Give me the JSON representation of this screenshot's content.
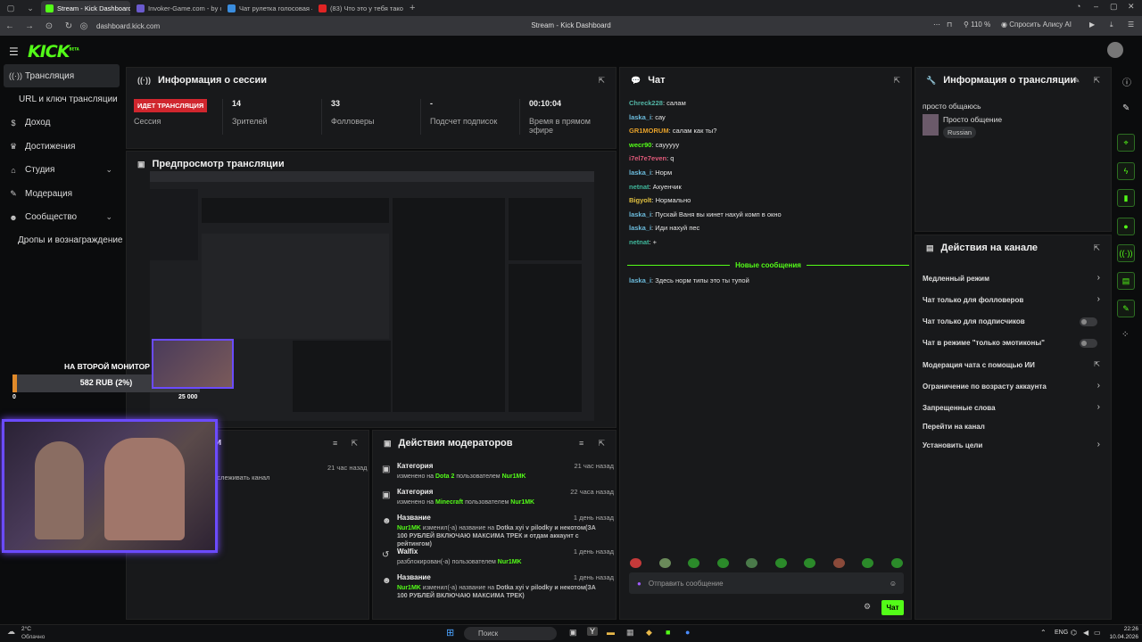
{
  "browser": {
    "tabs": [
      {
        "label": "Stream - Kick Dashboard",
        "color": "#53fc18",
        "active": true
      },
      {
        "label": "Invoker-Game.com - by co",
        "color": "#6a5acd",
        "active": false
      },
      {
        "label": "Чат рулетка голосовая –",
        "color": "#3a8dde",
        "active": false
      },
      {
        "label": "(83) Что это у тебя такое",
        "color": "#e02424",
        "active": false
      }
    ],
    "url": "dashboard.kick.com",
    "page_title": "Stream - Kick Dashboard",
    "zoom": "110 %",
    "alice": "Спросить Алису AI"
  },
  "kick": {
    "logo": "KICK",
    "logo_sup": "BETA"
  },
  "sidebar": {
    "items": [
      {
        "label": "Трансляция",
        "icon": "broadcast-icon"
      },
      {
        "label": "URL и ключ трансляции",
        "icon": ""
      },
      {
        "label": "Доход",
        "icon": "dollar-icon"
      },
      {
        "label": "Достижения",
        "icon": "trophy-icon"
      },
      {
        "label": "Студия",
        "icon": "studio-icon"
      },
      {
        "label": "Модерация",
        "icon": "wrench-icon"
      },
      {
        "label": "Сообщество",
        "icon": "community-icon"
      },
      {
        "label": "Дропы и вознаграждение",
        "icon": ""
      }
    ]
  },
  "session": {
    "title": "Информация о сессии",
    "live_badge": "ИДЕТ ТРАНСЛЯЦИЯ",
    "session_label": "Сессия",
    "viewers_value": "14",
    "viewers_label": "Зрителей",
    "followers_value": "33",
    "followers_label": "Фолловеры",
    "subs_value": "-",
    "subs_label": "Подсчет подписок",
    "time_value": "00:10:04",
    "time_label": "Время в прямом эфире"
  },
  "preview": {
    "title": "Предпросмотр трансляции"
  },
  "chat": {
    "title": "Чат",
    "messages": [
      {
        "user": "Chreck228",
        "text": "салам",
        "color": "#53b6a6"
      },
      {
        "user": "laska_i",
        "text": "сау",
        "color": "#6bbbdc"
      },
      {
        "user": "GR1MORUM",
        "text": "салам как ты?",
        "color": "#e6a12a"
      },
      {
        "user": "wecr90",
        "text": "сауyyyy",
        "color": "#53fc18"
      },
      {
        "user": "i7el7e7even",
        "text": "q",
        "color": "#e05a7a"
      },
      {
        "user": "laska_i",
        "text": "Норм",
        "color": "#6bbbdc"
      },
      {
        "user": "netnat",
        "text": "Ахуенчик",
        "color": "#3fb69a"
      },
      {
        "user": "Bigyolt",
        "text": "Нормально",
        "color": "#e0c040"
      },
      {
        "user": "laska_i",
        "text": "Пускай Ваня вы кинет нахуй комп в окно",
        "color": "#6bbbdc"
      },
      {
        "user": "laska_i",
        "text": "Иди нахуй пес",
        "color": "#6bbbdc"
      },
      {
        "user": "netnat",
        "text": "+",
        "color": "#3fb69a"
      }
    ],
    "new_messages_label": "Новые сообщения",
    "new_messages": [
      {
        "user": "laska_i",
        "text": "Здесь норм типы это ты тупой",
        "color": "#6bbbdc"
      }
    ],
    "input_placeholder": "Отправить сообщение",
    "send_label": "Чат"
  },
  "stream_info": {
    "title": "Информация о трансляции",
    "stream_title": "просто общаюсь",
    "category": "Просто общение",
    "language": "Russian"
  },
  "channel_actions": {
    "title": "Действия на канале",
    "items": [
      {
        "label": "Медленный режим",
        "control": "chevron"
      },
      {
        "label": "Чат только для фолловеров",
        "control": "chevron"
      },
      {
        "label": "Чат только для подписчиков",
        "control": "toggle"
      },
      {
        "label": "Чат в режиме \"только эмотиконы\"",
        "control": "toggle"
      },
      {
        "label": "Модерация чата с помощью ИИ",
        "control": "external"
      },
      {
        "label": "Ограничение по возрасту аккаунта",
        "control": "chevron"
      },
      {
        "label": "Запрещенные слова",
        "control": "chevron"
      },
      {
        "label": "Перейти на канал",
        "control": "none"
      },
      {
        "label": "Установить цели",
        "control": "chevron"
      }
    ]
  },
  "activity": {
    "title_fragment": "сти",
    "time": "21 час назад",
    "text_fragment": "тслеживать канал"
  },
  "mod_actions": {
    "title": "Действия модераторов",
    "items": [
      {
        "title": "Категория",
        "time": "21 час назад",
        "pre": "изменено на",
        "hl1": "Dota 2",
        "mid": "пользователем",
        "hl2": "Nur1MK",
        "post": ""
      },
      {
        "title": "Категория",
        "time": "22 часа назад",
        "pre": "изменено на",
        "hl1": "Minecraft",
        "mid": "пользователем",
        "hl2": "Nur1MK",
        "post": ""
      },
      {
        "title": "Название",
        "time": "1 день назад",
        "pre": "",
        "hl1": "Nur1MK",
        "mid": "изменил(-а) название на",
        "hl2": "",
        "post": "Dotka xyi v pilodky и некотом(ЗА 100 РУБЛЕЙ ВКЛЮЧАЮ МАКСИМА ТРЕК и отдам аккаунт с рейтингом)"
      },
      {
        "title": "Walfix",
        "time": "1 день назад",
        "pre": "разблокирован(-а) пользователем",
        "hl1": "Nur1MK",
        "mid": "",
        "hl2": "",
        "post": ""
      },
      {
        "title": "Название",
        "time": "1 день назад",
        "pre": "",
        "hl1": "Nur1MK",
        "mid": "изменил(-а) название на",
        "hl2": "",
        "post": "Dotka xyi v pilodky и некотом(ЗА 100 РУБЛЕЙ ВКЛЮЧАЮ МАКСИМА ТРЕК)"
      }
    ]
  },
  "overlay": {
    "monitor_label": "НА ВТОРОЙ МОНИТОР",
    "goal": "582 RUB (2%)",
    "goal_progress": 0.023,
    "min": "0",
    "max": "25 000"
  },
  "taskbar": {
    "weather_temp": "2°C",
    "weather_desc": "Облачно",
    "search": "Поиск",
    "lang": "ENG",
    "time": "22:26",
    "date": "10.04.2026"
  }
}
